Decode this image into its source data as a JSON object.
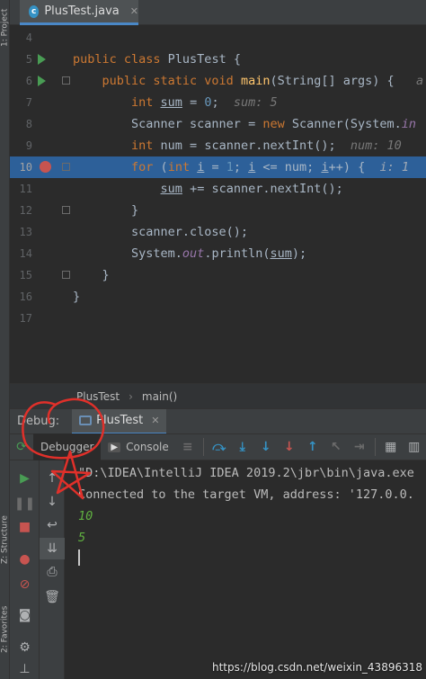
{
  "left_strip": {
    "project_tab": "1: Project",
    "structure_tab": "Z: Structure",
    "favorites_tab": "2: Favorites"
  },
  "tab": {
    "label": "PlusTest.java",
    "icon": "c"
  },
  "editor": {
    "line_numbers": [
      "4",
      "5",
      "6",
      "7",
      "8",
      "9",
      "10",
      "11",
      "12",
      "13",
      "14",
      "15",
      "16",
      "17"
    ],
    "hints": {
      "sum": "sum: 5",
      "num": "num: 10",
      "i": "i: 1",
      "args": "a"
    }
  },
  "breadcrumb": {
    "class": "PlusTest",
    "method": "main()"
  },
  "debug": {
    "label": "Debug:",
    "session": "PlusTest"
  },
  "debug_toolbar": {
    "debugger_tab": "Debugger",
    "console_tab": "Console"
  },
  "console": {
    "lines": [
      "\"D:\\IDEA\\IntelliJ IDEA 2019.2\\jbr\\bin\\java.exe",
      "Connected to the target VM, address: '127.0.0.",
      "10",
      "5"
    ]
  },
  "watermark": "https://blog.csdn.net/weixin_43896318",
  "colors": {
    "accent": "#4a88c7",
    "highlight": "#2d6099",
    "run": "#499c54",
    "breakpoint": "#c75450",
    "annotation": "#e0302a"
  }
}
